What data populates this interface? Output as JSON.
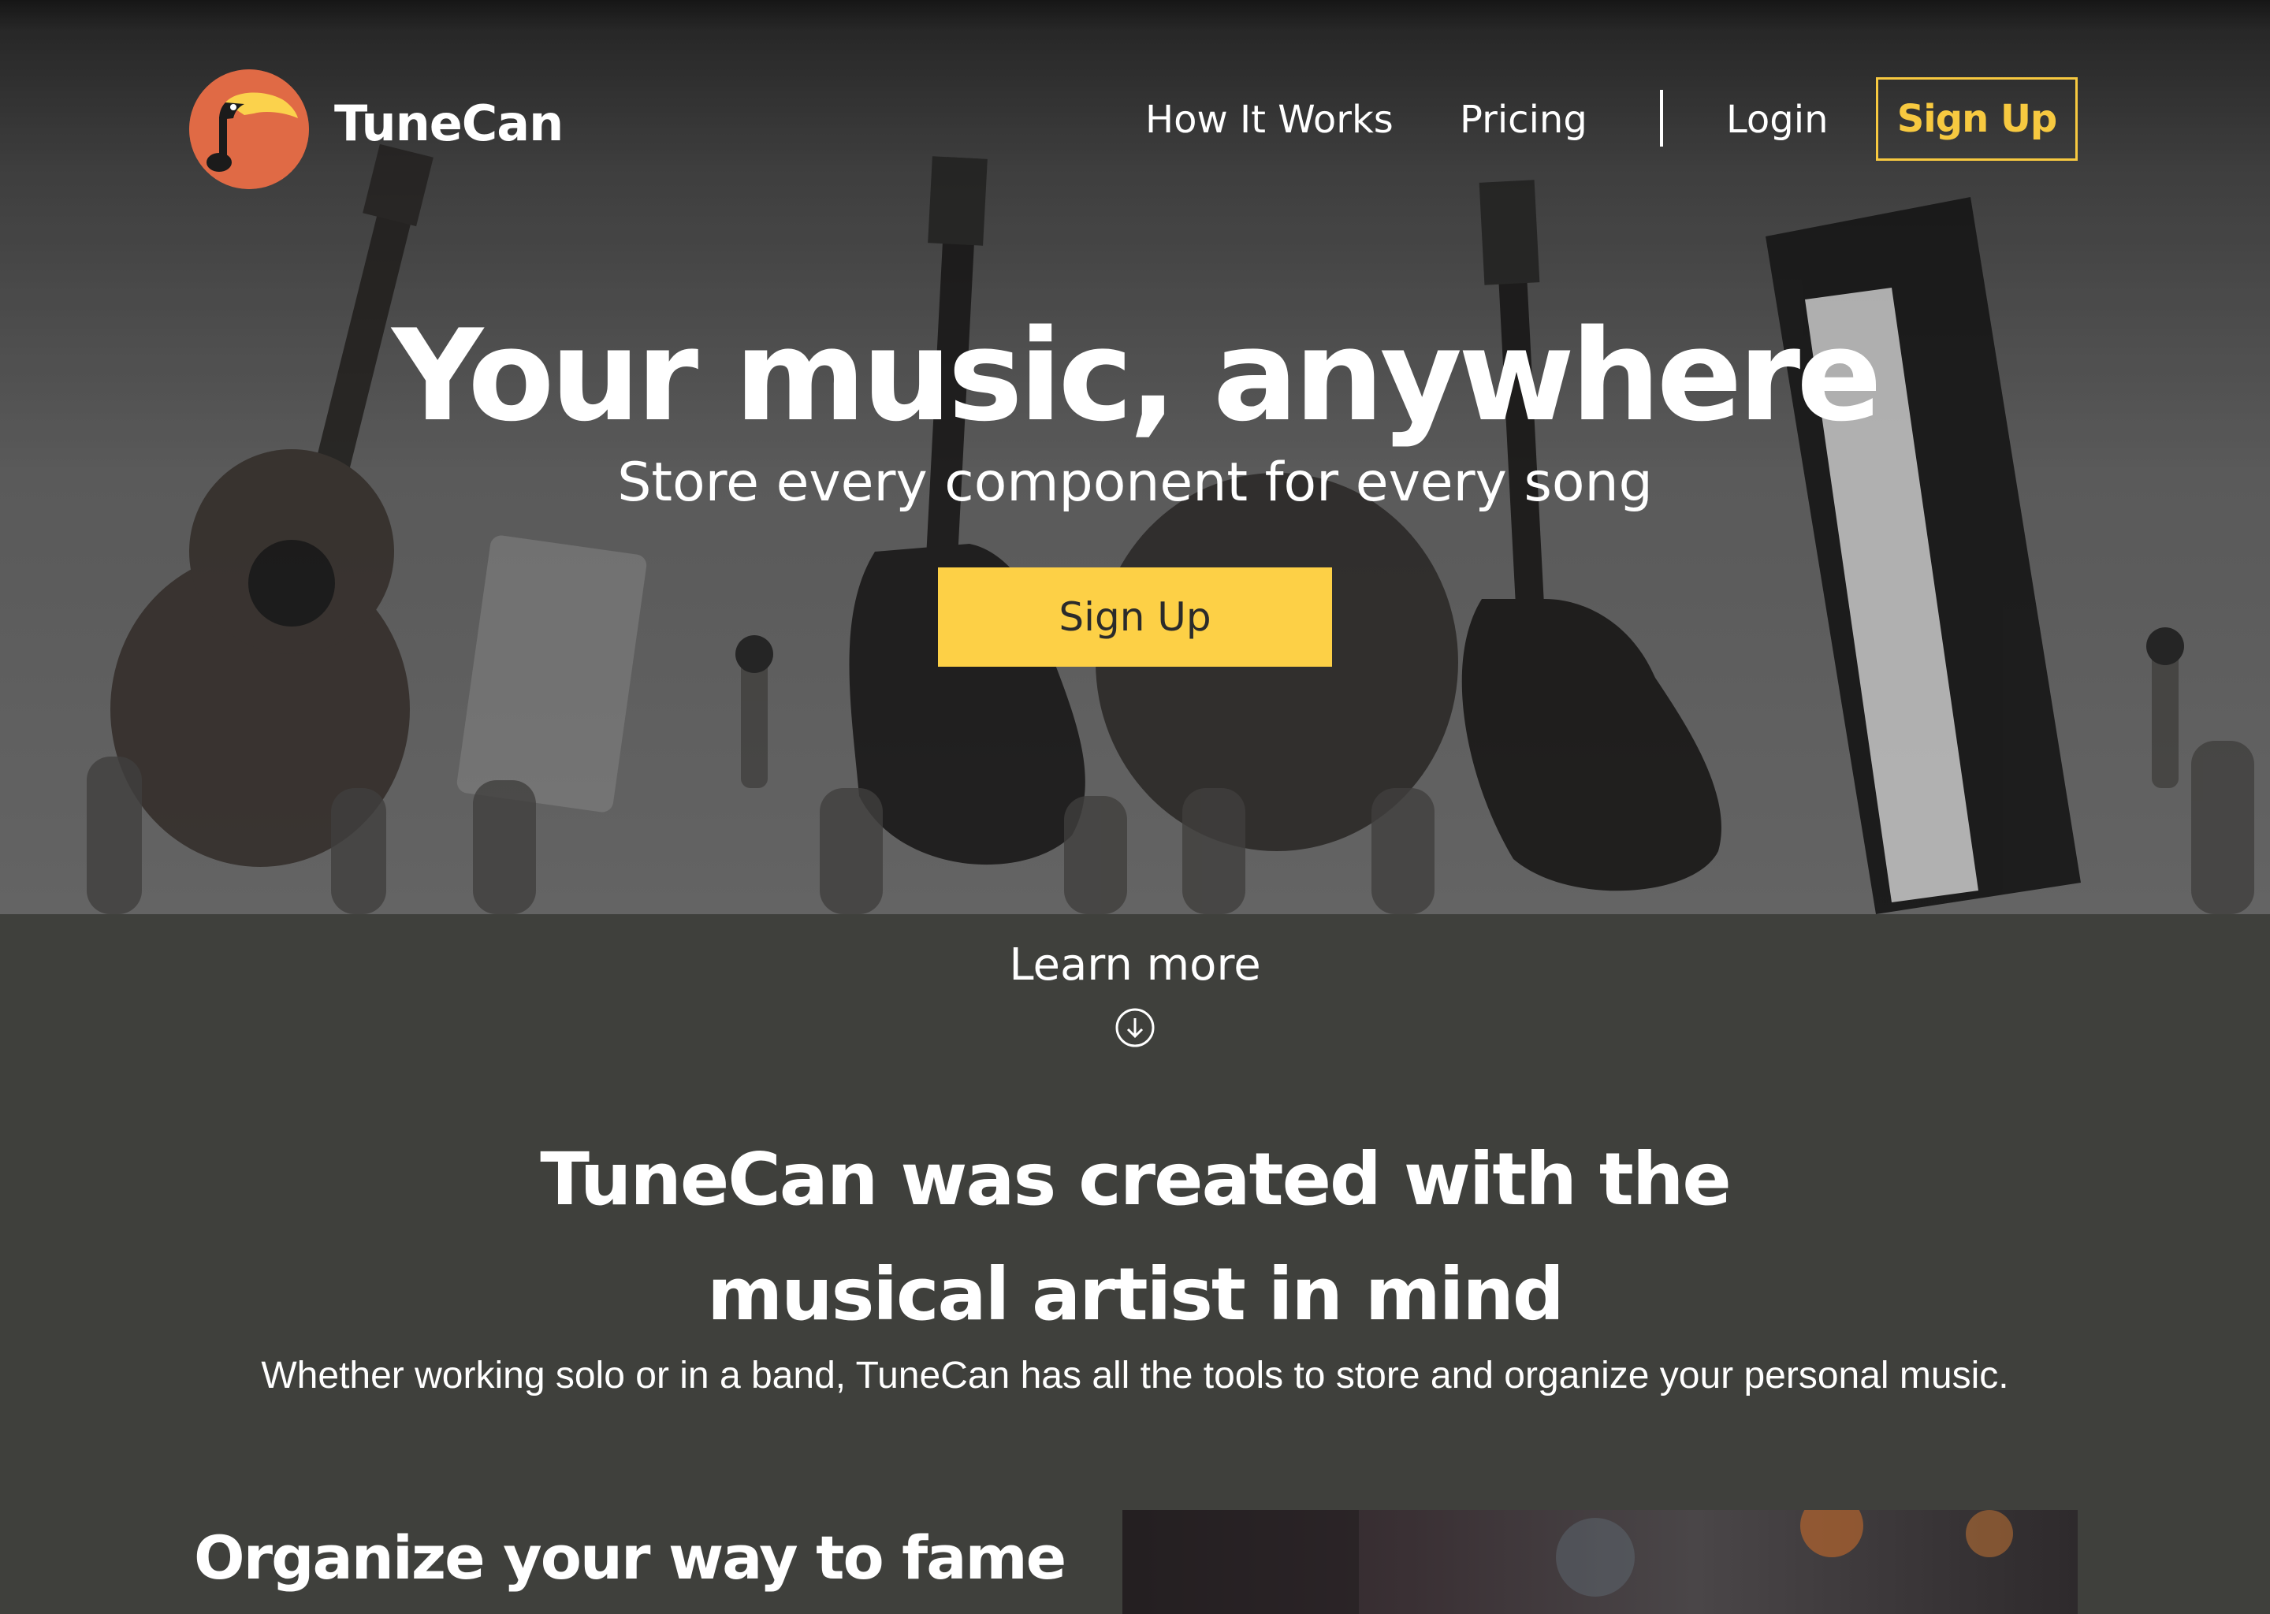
{
  "brand": {
    "name": "TuneCan",
    "logo_color": "#e06a45"
  },
  "nav": {
    "items": [
      {
        "label": "How It Works"
      },
      {
        "label": "Pricing"
      },
      {
        "label": "Login"
      }
    ],
    "signup_label": "Sign Up",
    "accent": "#f7c940"
  },
  "hero": {
    "title": "Your music, anywhere",
    "subtitle": "Store every component for every song",
    "cta_label": "Sign Up",
    "cta_color": "#fdd046"
  },
  "learn_more": {
    "label": "Learn more",
    "icon": "arrow-down-circle-icon"
  },
  "about": {
    "title_line1": "TuneCan was created with the",
    "title_line2": "musical artist in mind",
    "description": "Whether working solo or in a band, TuneCan has all the tools to store and organize your personal music."
  },
  "feature": {
    "title": "Organize your way to fame"
  },
  "colors": {
    "section_bg": "#3f403c",
    "text": "#ffffff"
  }
}
